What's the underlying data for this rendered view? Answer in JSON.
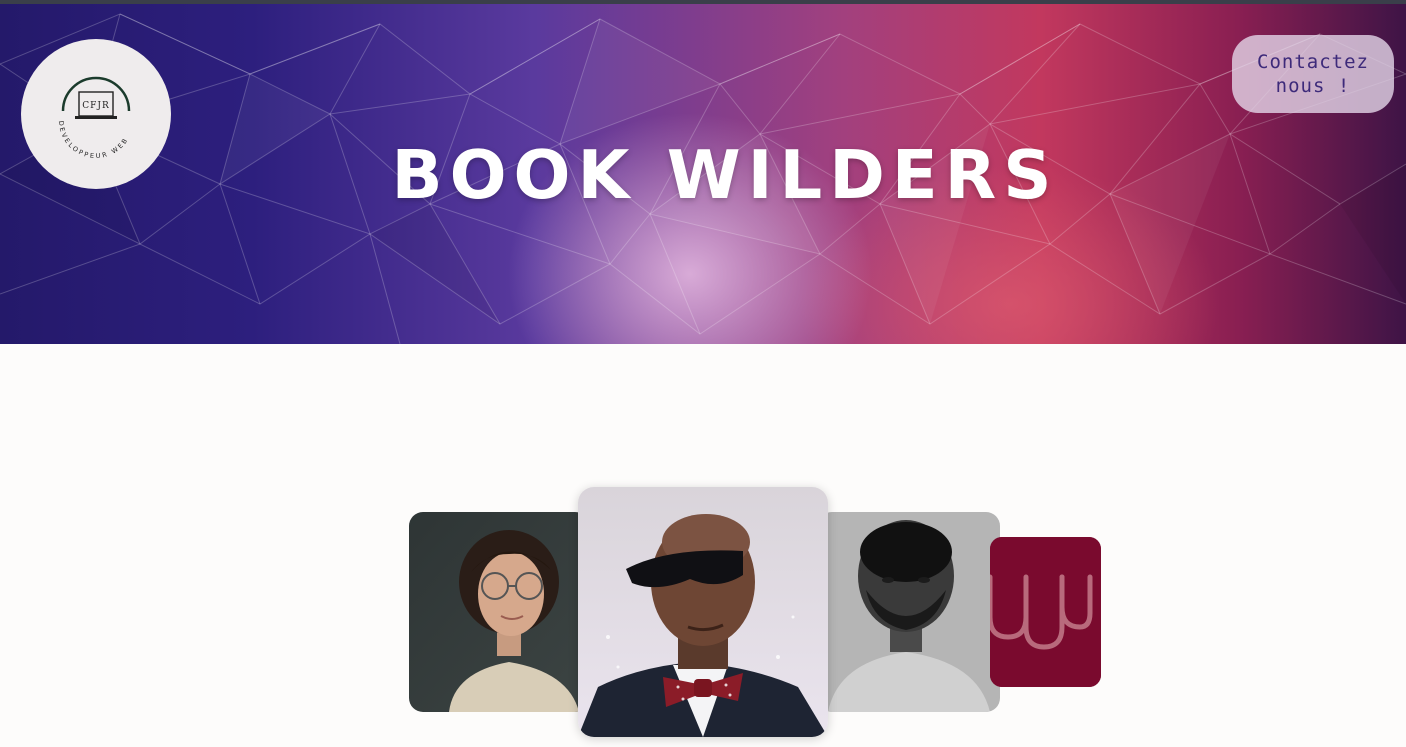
{
  "topbar": {
    "color": "#3a3f4a"
  },
  "header": {
    "title": "BOOK WILDERS",
    "contact_button": "Contactez nous !",
    "logo": {
      "initials": "CFJR",
      "ring_text": "DEVELOPPEUR WEB",
      "icon": "laptop-arch-icon"
    }
  },
  "carousel": {
    "cards": [
      {
        "name": "portrait-woman-glasses"
      },
      {
        "name": "portrait-man-sunglasses-bowtie"
      },
      {
        "name": "portrait-man-grayscale"
      },
      {
        "name": "wild-code-school-logo",
        "color": "#7a0a2e"
      }
    ]
  },
  "colors": {
    "contact_text": "#3d2a7a",
    "page_bg": "#fdfcfb"
  }
}
